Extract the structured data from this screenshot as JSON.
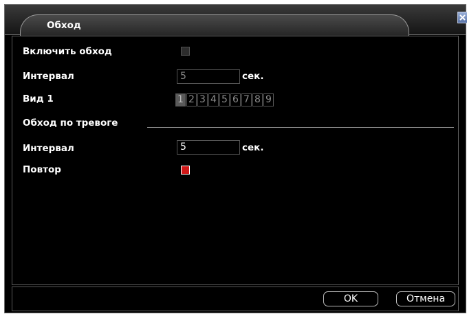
{
  "window": {
    "title": "Обход"
  },
  "fields": {
    "enable_tour_label": "Включить обход",
    "interval_label": "Интервал",
    "interval_value": "5",
    "interval_unit": "сек.",
    "view_label": "Вид 1",
    "view_buttons": [
      "1",
      "2",
      "3",
      "4",
      "5",
      "6",
      "7",
      "8",
      "9"
    ],
    "view_active_index": 0
  },
  "alarm": {
    "section_label": "Обход по тревоге",
    "interval_label": "Интервал",
    "interval_value": "5",
    "interval_unit": "сек.",
    "repeat_label": "Повтор"
  },
  "state": {
    "enable_tour_checked": false,
    "repeat_checked": true
  },
  "buttons": {
    "ok": "OK",
    "cancel": "Отмена"
  },
  "colors": {
    "background": "#000000",
    "checked_red": "#d01818",
    "text": "#ffffff"
  },
  "icons": {
    "close": "close-icon"
  }
}
